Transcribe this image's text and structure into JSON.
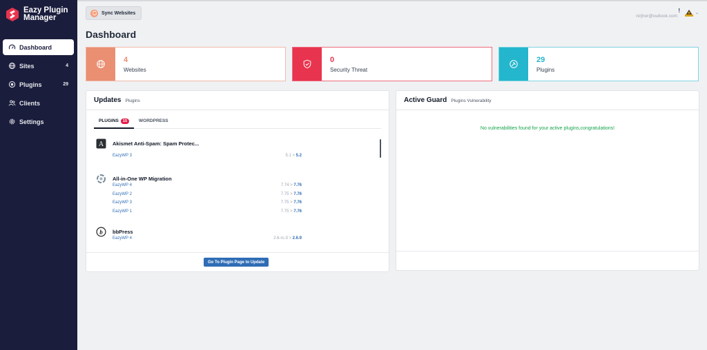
{
  "app": {
    "logo_text": "Eazy Plugin Manager"
  },
  "sidebar": {
    "items": [
      {
        "label": "Dashboard",
        "count": ""
      },
      {
        "label": "Sites",
        "count": "4"
      },
      {
        "label": "Plugins",
        "count": "29"
      },
      {
        "label": "Clients",
        "count": ""
      },
      {
        "label": "Settings",
        "count": ""
      }
    ]
  },
  "topbar": {
    "sync_label": "Sync Websites",
    "user_email": "nirjhor@outlook.com",
    "notification_mark": "!"
  },
  "page": {
    "title": "Dashboard"
  },
  "stats": [
    {
      "value": "4",
      "label": "Websites",
      "color": "#ea8f72",
      "border": "#f2b8a8"
    },
    {
      "value": "0",
      "label": "Security Threat",
      "color": "#e8344e",
      "border": "#ef6b7d"
    },
    {
      "value": "29",
      "label": "Plugins",
      "color": "#23b6cc",
      "border": "#7fd4e0"
    }
  ],
  "updates": {
    "title": "Updates",
    "subtitle": "Plugins",
    "tabs": [
      {
        "label": "PLUGINS",
        "badge": "15"
      },
      {
        "label": "WORDPRESS",
        "badge": ""
      }
    ],
    "plugins": [
      {
        "name": "Akismet Anti-Spam: Spam Protec...",
        "icon": "akismet-icon",
        "sites": [
          {
            "site": "EazyWP 3",
            "from": "5.1 > ",
            "to": "5.2"
          }
        ]
      },
      {
        "name": "All-in-One WP Migration",
        "icon": "migration-icon",
        "sites": [
          {
            "site": "EazyWP 4",
            "from": "7.74 > ",
            "to": "7.76"
          },
          {
            "site": "EazyWP 2",
            "from": "7.75 > ",
            "to": "7.76"
          },
          {
            "site": "EazyWP 3",
            "from": "7.75 > ",
            "to": "7.76"
          },
          {
            "site": "EazyWP 1",
            "from": "7.75 > ",
            "to": "7.76"
          }
        ]
      },
      {
        "name": "bbPress",
        "icon": "bbpress-icon",
        "sites": [
          {
            "site": "EazyWP 4",
            "from": "2.6-rc-3 > ",
            "to": "2.6.9"
          }
        ]
      }
    ],
    "button_label": "Go To Plugin Page to Update"
  },
  "guard": {
    "title": "Active Guard",
    "subtitle": "Plugins Vulnerability",
    "message": "No vulnerabilities found for your active plugins,congratulations!"
  }
}
